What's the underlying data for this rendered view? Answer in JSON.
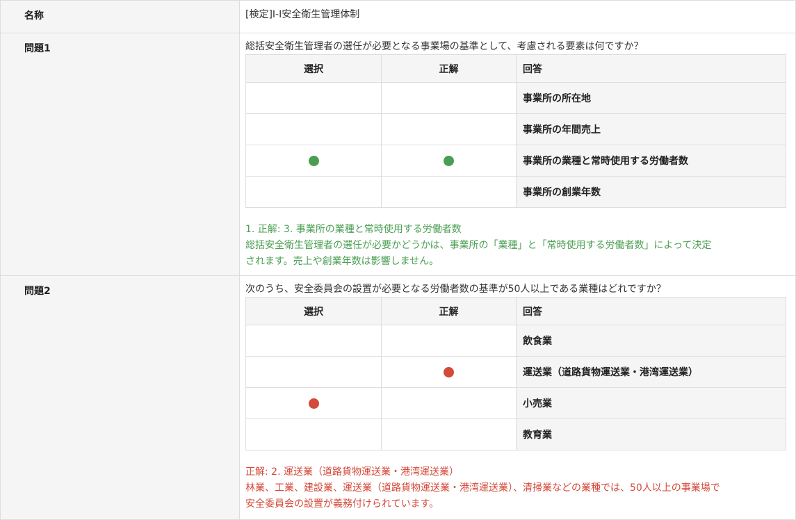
{
  "colors": {
    "correct": "#4a9e52",
    "incorrect": "#d3493a",
    "header_bg": "#f5f5f5",
    "border": "#dddddd"
  },
  "name_row": {
    "label": "名称",
    "value": "[検定]I-I安全衛生管理体制"
  },
  "table_headers": {
    "select": "選択",
    "correct": "正解",
    "answer": "回答"
  },
  "questions": [
    {
      "label": "問題1",
      "text": "総括安全衛生管理者の選任が必要となる事業場の基準として、考慮される要素は何ですか？",
      "options": [
        {
          "answer": "事業所の所在地",
          "selected": false,
          "correct": false
        },
        {
          "answer": "事業所の年間売上",
          "selected": false,
          "correct": false
        },
        {
          "answer": "事業所の業種と常時使用する労働者数",
          "selected": true,
          "correct": true
        },
        {
          "answer": "事業所の創業年数",
          "selected": false,
          "correct": false
        }
      ],
      "result": "correct",
      "feedback_title": "1. 正解: 3. 事業所の業種と常時使用する労働者数",
      "feedback_line1": "総括安全衛生管理者の選任が必要かどうかは、事業所の「業種」と「常時使用する労働者数」によって決定",
      "feedback_line2": "されます。売上や創業年数は影響しません。"
    },
    {
      "label": "問題2",
      "text": "次のうち、安全委員会の設置が必要となる労働者数の基準が50人以上である業種はどれですか？",
      "options": [
        {
          "answer": "飲食業",
          "selected": false,
          "correct": false
        },
        {
          "answer": "運送業（道路貨物運送業・港湾運送業）",
          "selected": false,
          "correct": true
        },
        {
          "answer": "小売業",
          "selected": true,
          "correct": false
        },
        {
          "answer": "教育業",
          "selected": false,
          "correct": false
        }
      ],
      "result": "incorrect",
      "feedback_title": "正解: 2. 運送業（道路貨物運送業・港湾運送業）",
      "feedback_line1": "林業、工業、建設業、運送業（道路貨物運送業・港湾運送業）、清掃業などの業種では、50人以上の事業場で",
      "feedback_line2": "安全委員会の設置が義務付けられています。"
    }
  ]
}
